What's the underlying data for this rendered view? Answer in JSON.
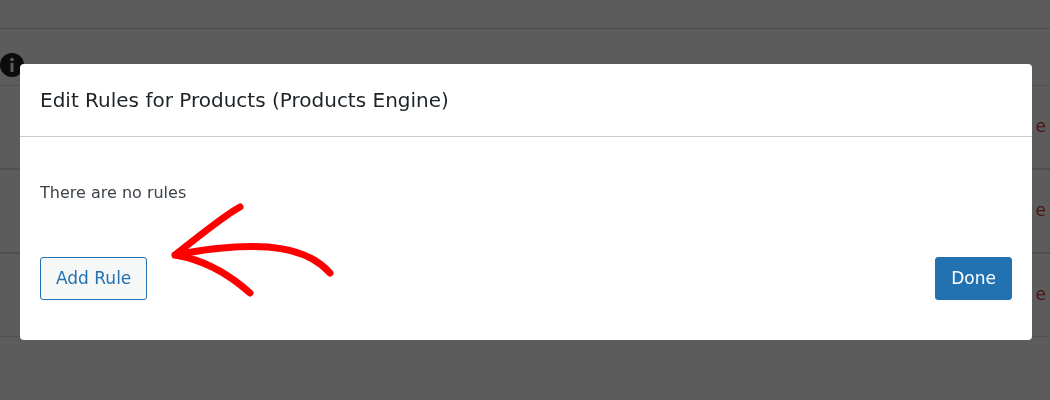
{
  "background": {
    "rows": [
      {
        "column_2": "e"
      },
      {
        "column_2": "e"
      },
      {
        "column_2": "e"
      }
    ]
  },
  "modal": {
    "title": "Edit Rules for Products (Products Engine)",
    "message": "There are no rules",
    "buttons": [
      {
        "label": "Add Rule",
        "kind": "secondary"
      },
      {
        "label": "Done",
        "kind": "primary"
      }
    ]
  }
}
